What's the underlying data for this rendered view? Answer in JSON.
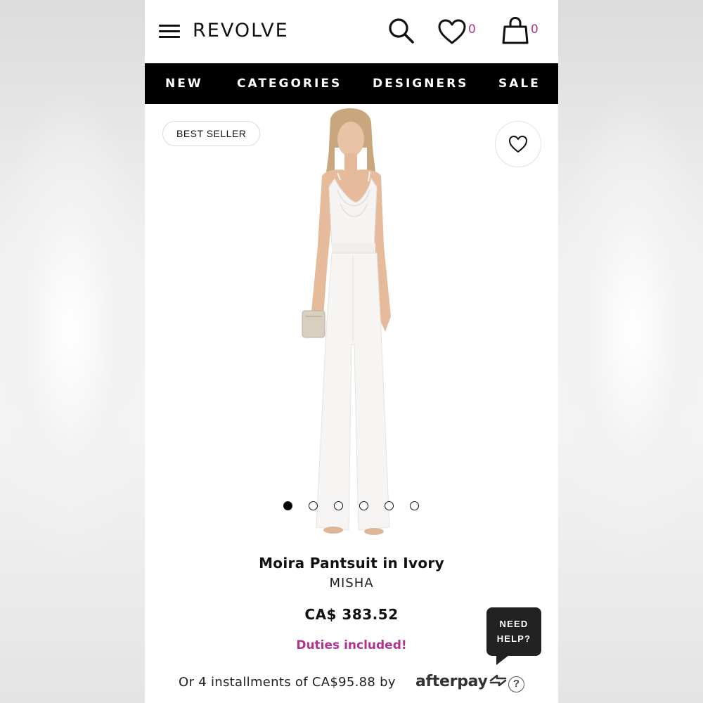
{
  "header": {
    "logo": "REVOLVE",
    "wishlist_count": "0",
    "bag_count": "0"
  },
  "nav": {
    "items": [
      "NEW",
      "CATEGORIES",
      "DESIGNERS",
      "SALE"
    ]
  },
  "gallery": {
    "badge": "BEST SELLER",
    "slide_count": 6,
    "active_slide": 1
  },
  "product": {
    "name": "Moira Pantsuit in Ivory",
    "brand": "MISHA",
    "price": "CA$ 383.52",
    "duties": "Duties included!",
    "installments": "Or 4 installments of CA$95.88 by",
    "afterpay": "afterpay",
    "afterpay_help": "?"
  },
  "help_widget": {
    "line1": "NEED",
    "line2": "HELP?"
  },
  "colors": {
    "accent": "#b0338f",
    "nav_bg": "#000000",
    "text": "#111111"
  }
}
